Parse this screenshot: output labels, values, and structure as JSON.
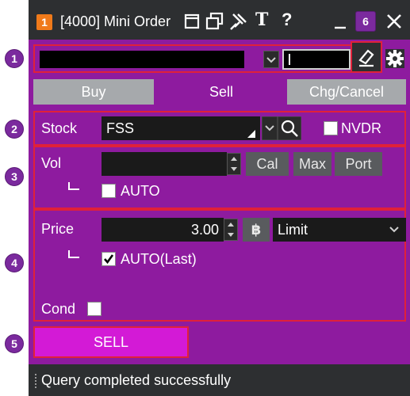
{
  "markers": [
    "1",
    "2",
    "3",
    "4",
    "5",
    "6"
  ],
  "titlebar": {
    "badge": "1",
    "title": "[4000] Mini Order",
    "text_tool": "T",
    "help": "?"
  },
  "toolbar": {
    "account_value": "",
    "password_value": ""
  },
  "tabs": {
    "buy": "Buy",
    "sell": "Sell",
    "chg_cancel": "Chg/Cancel"
  },
  "stock": {
    "label": "Stock",
    "value": "FSS",
    "nvdr_label": "NVDR",
    "nvdr_checked": false
  },
  "volume": {
    "label": "Vol",
    "value": "",
    "cal": "Cal",
    "max": "Max",
    "port": "Port",
    "auto_label": "AUTO",
    "auto_checked": false
  },
  "price": {
    "label": "Price",
    "value": "3.00",
    "currency": "฿",
    "type": "Limit",
    "auto_last_label": "AUTO(Last)",
    "auto_last_checked": true,
    "cond_label": "Cond",
    "cond_checked": false
  },
  "action": {
    "sell_label": "SELL"
  },
  "status": {
    "message": "Query completed successfully"
  },
  "colors": {
    "panel": "#8e1b9f",
    "sell_button": "#d31ad6",
    "titlebar": "#2d2f31",
    "highlight": "#e0213a",
    "marker": "#7b2a9e"
  }
}
